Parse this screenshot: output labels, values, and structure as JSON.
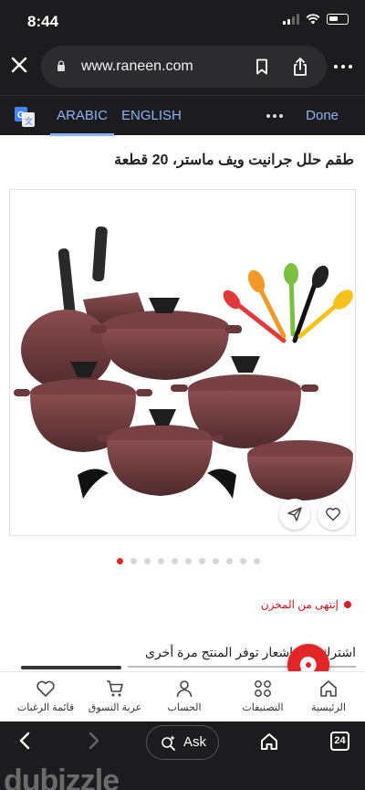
{
  "status": {
    "time": "8:44"
  },
  "browser": {
    "url": "www.raneen.com",
    "translate": {
      "lang_source": "ARABIC",
      "lang_target": "ENGLISH",
      "done": "Done"
    },
    "toolbar": {
      "ask": "Ask",
      "tab_count": "24"
    }
  },
  "product": {
    "title": "طقم حلل جرانيت ويف ماستر، 20 قطعة",
    "gallery_dots": 11,
    "gallery_active": 0,
    "stock_status": "إنتهى من المخزن",
    "notify_text": "اشترك ليتم إشعار توفر المنتج مرة أخرى"
  },
  "bottom_nav": [
    {
      "label": "قائمة الرغبات",
      "icon": "heart-icon"
    },
    {
      "label": "عربة التسوق",
      "icon": "cart-icon"
    },
    {
      "label": "الحساب",
      "icon": "user-icon"
    },
    {
      "label": "التصنيفات",
      "icon": "grid-icon"
    },
    {
      "label": "الرئيسية",
      "icon": "home-icon"
    }
  ],
  "watermark": "dubizzle",
  "colors": {
    "brand_red": "#e32527",
    "link_blue": "#8ab4f8",
    "cookware": "#6b3a3d"
  }
}
